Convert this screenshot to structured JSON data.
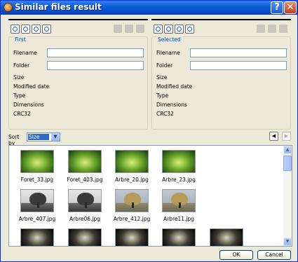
{
  "window": {
    "title": "Similar files result",
    "help_label": "?",
    "close_label": "✕"
  },
  "first": {
    "title": "First",
    "labels": [
      "Filename",
      "Folder",
      "Size",
      "Modified date",
      "Type",
      "Dimensions",
      "CRC32"
    ]
  },
  "selected": {
    "title": "Selected",
    "labels": [
      "Filename",
      "Folder",
      "Size",
      "Modified date",
      "Type",
      "Dimensions",
      "CRC32"
    ]
  },
  "toolbar": {
    "icons": [
      "zoom-out-icon",
      "zoom-in-icon",
      "zoom-fit-icon",
      "actual-size-icon"
    ],
    "right_icons": [
      "copy-icon",
      "move-icon",
      "delete-icon"
    ]
  },
  "sort": {
    "label": "Sort by",
    "value": "Size"
  },
  "files": [
    {
      "name": "Foret_33.jpg",
      "kind": "forest"
    },
    {
      "name": "Foret_403.jpg",
      "kind": "forest"
    },
    {
      "name": "Arbre_20.jpg",
      "kind": "forest"
    },
    {
      "name": "Arbre_23.jpg",
      "kind": "forest"
    },
    {
      "name": "Arbre_407.jpg",
      "kind": "tree"
    },
    {
      "name": "Arbre06.jpg",
      "kind": "tree"
    },
    {
      "name": "Arbre_412.jpg",
      "kind": "autumn"
    },
    {
      "name": "Arbre11.jpg",
      "kind": "autumn"
    },
    {
      "name": "",
      "kind": "dark"
    },
    {
      "name": "",
      "kind": "dark"
    },
    {
      "name": "",
      "kind": "dark"
    },
    {
      "name": "",
      "kind": "dark"
    },
    {
      "name": "",
      "kind": "dark"
    }
  ],
  "buttons": {
    "ok": "OK",
    "cancel": "Cancel"
  }
}
